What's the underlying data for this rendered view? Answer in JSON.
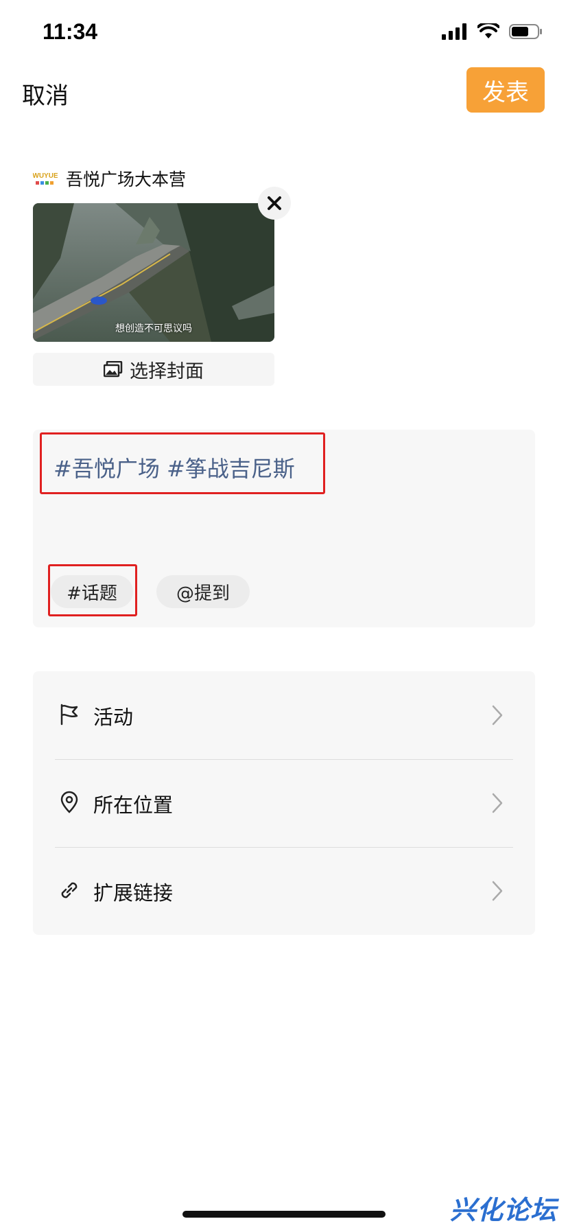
{
  "status_bar": {
    "time": "11:34",
    "icons": [
      "signal-icon",
      "wifi-icon",
      "battery-icon"
    ]
  },
  "nav": {
    "cancel_label": "取消",
    "publish_label": "发表",
    "publish_color": "#f7a137"
  },
  "account": {
    "name": "吾悦广场大本营",
    "logo_text": "WUYUE"
  },
  "video": {
    "caption": "想创造不可思议吗"
  },
  "cover": {
    "label": "选择封面",
    "icon": "image-icon"
  },
  "post": {
    "text": "#吾悦广场 #筝战吉尼斯",
    "text_color": "#4a6189",
    "topic_label": "#话题",
    "mention_label": "@提到"
  },
  "options": [
    {
      "label": "活动",
      "icon": "flag-icon"
    },
    {
      "label": "所在位置",
      "icon": "location-pin-icon"
    },
    {
      "label": "扩展链接",
      "icon": "link-icon"
    }
  ],
  "watermark": "兴化论坛"
}
